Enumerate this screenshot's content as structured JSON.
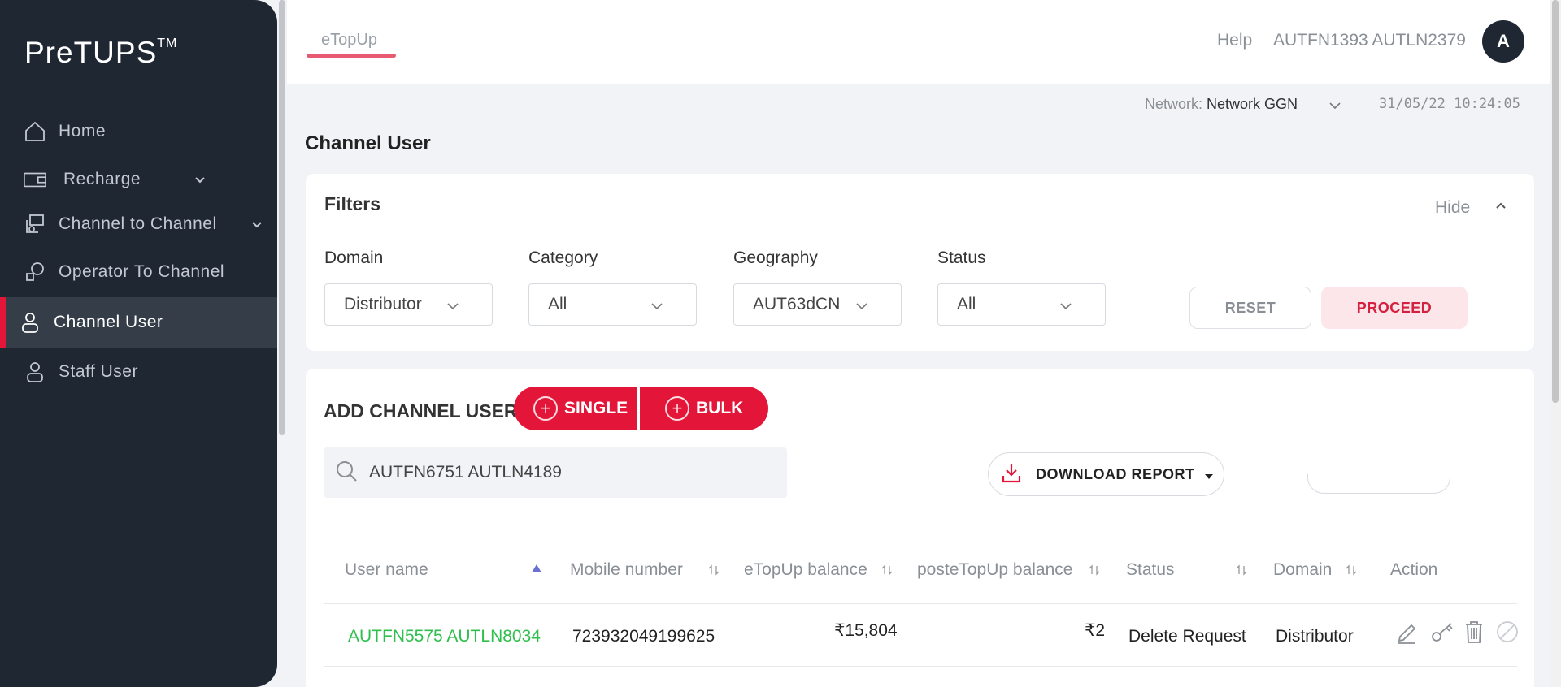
{
  "app": {
    "logo": "PreTUPS",
    "logo_tm": "TM"
  },
  "sidebar": {
    "items": [
      {
        "label": "Home",
        "icon": "home-icon"
      },
      {
        "label": "Recharge",
        "icon": "recharge-icon",
        "expandable": true
      },
      {
        "label": "Channel to Channel",
        "icon": "channel-to-channel-icon",
        "expandable": true
      },
      {
        "label": "Operator To Channel",
        "icon": "operator-to-channel-icon"
      },
      {
        "label": "Channel User",
        "icon": "user-icon",
        "active": true
      },
      {
        "label": "Staff User",
        "icon": "user-icon"
      }
    ]
  },
  "header": {
    "tab": "eTopUp",
    "help": "Help",
    "username": "AUTFN1393 AUTLN2379",
    "avatar": "A",
    "network_label": "Network:",
    "network_value": "Network GGN",
    "datetime": "31/05/22 10:24:05"
  },
  "page": {
    "title": "Channel User"
  },
  "filters": {
    "title": "Filters",
    "hide": "Hide",
    "fields": [
      {
        "label": "Domain",
        "value": "Distributor"
      },
      {
        "label": "Category",
        "value": "All"
      },
      {
        "label": "Geography",
        "value": "AUT63dCN"
      },
      {
        "label": "Status",
        "value": "All"
      }
    ],
    "reset": "RESET",
    "proceed": "PROCEED"
  },
  "users": {
    "add_title": "ADD CHANNEL USER",
    "single": "SINGLE",
    "bulk": "BULK",
    "search_value": "AUTFN6751 AUTLN4189",
    "download": "DOWNLOAD REPORT",
    "columns": [
      "User name",
      "Mobile number",
      "eTopUp balance",
      "posteTopUp balance",
      "Status",
      "Domain",
      "Action"
    ],
    "rows": [
      {
        "user_name": "AUTFN5575 AUTLN8034",
        "mobile": "723932049199625",
        "etopup": "₹15,804",
        "postetopup": "₹2",
        "status": "Delete Request",
        "domain": "Distributor"
      }
    ]
  },
  "colors": {
    "sidebar_bg": "#1f2733",
    "accent": "#e3163a",
    "user_link": "#2fbf4d"
  }
}
